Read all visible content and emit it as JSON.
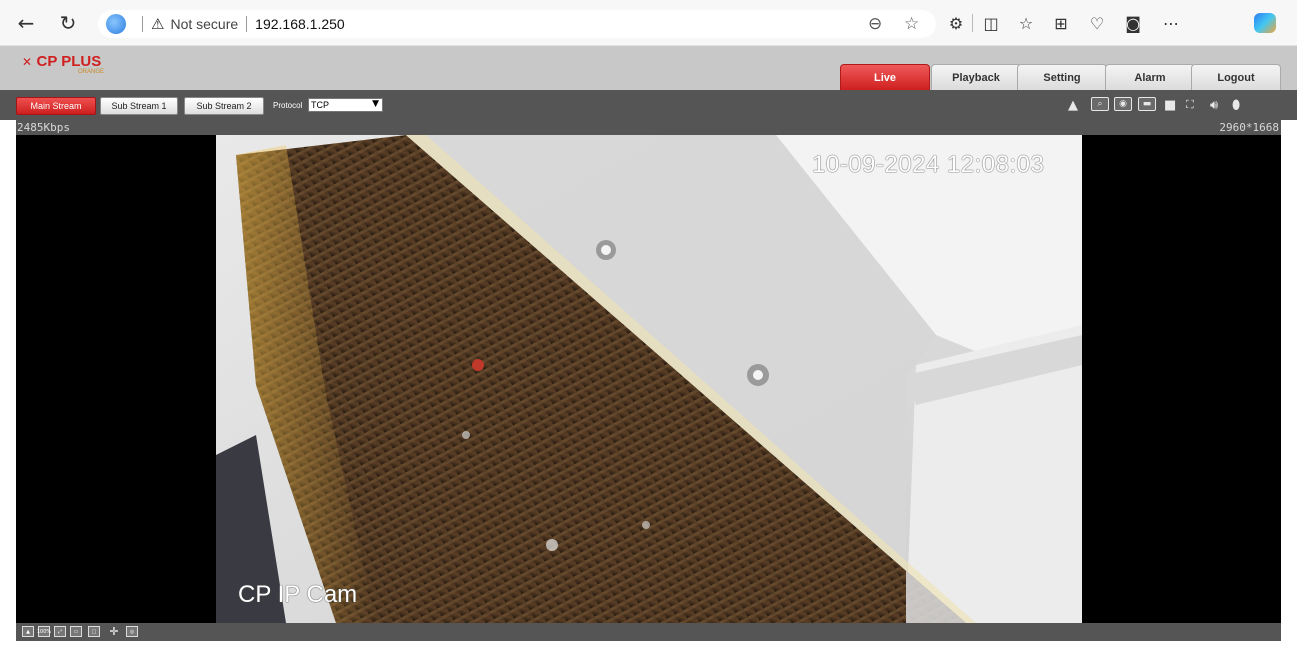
{
  "browser": {
    "security_label": "Not secure",
    "url": "192.168.1.250"
  },
  "app": {
    "logo_text": "CP PLUS",
    "logo_sub": "ORANGE",
    "tabs": [
      {
        "label": "Live",
        "active": true
      },
      {
        "label": "Playback",
        "active": false
      },
      {
        "label": "Setting",
        "active": false
      },
      {
        "label": "Alarm",
        "active": false
      },
      {
        "label": "Logout",
        "active": false
      }
    ],
    "accent_color": "#d42020"
  },
  "stream": {
    "buttons": [
      {
        "label": "Main Stream",
        "active": true
      },
      {
        "label": "Sub Stream 1",
        "active": false
      },
      {
        "label": "Sub Stream 2",
        "active": false
      }
    ],
    "protocol_label": "Protocol",
    "protocol_value": "TCP",
    "controls": [
      "user-icon",
      "zoom-icon",
      "snapshot-icon",
      "triple-snapshot-icon",
      "record-icon",
      "fullscreen-icon",
      "volume-icon",
      "microphone-icon"
    ]
  },
  "video": {
    "bitrate": "2485Kbps",
    "resolution": "2960*1668",
    "osd_time": "10-09-2024 12:08:03",
    "osd_name": "CP IP Cam"
  },
  "bottom_bar": {
    "icons": [
      "view-mode-icon",
      "zoom-100-icon",
      "fit-icon",
      "wide-icon",
      "original-icon",
      "ptz-icon",
      "fisheye-icon"
    ],
    "zoom_100_label": "100%"
  }
}
